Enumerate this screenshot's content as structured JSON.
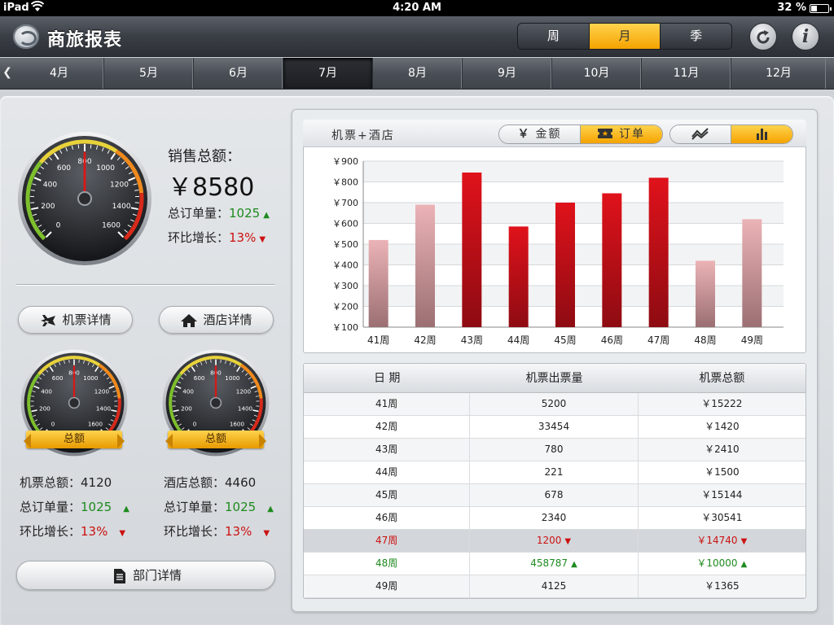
{
  "status_bar": {
    "device": "iPad",
    "time": "4:20 AM",
    "battery": "32 %"
  },
  "header": {
    "title": "商旅报表",
    "periods": [
      {
        "label": "周"
      },
      {
        "label": "月",
        "active": true
      },
      {
        "label": "季"
      }
    ],
    "refresh_icon": "refresh-icon",
    "info_icon": "info-icon",
    "info_label": "i"
  },
  "months": {
    "items": [
      "4月",
      "5月",
      "6月",
      "7月",
      "8月",
      "9月",
      "10月",
      "11月",
      "12月"
    ],
    "active": "7月"
  },
  "summary": {
    "sales_label": "销售总额：",
    "sales_value": "￥8580",
    "orders_label": "总订单量：",
    "orders_value": "1025",
    "growth_label": "环比增长：",
    "growth_value": "13%",
    "gauge_ticks": [
      "0",
      "200",
      "400",
      "600",
      "800",
      "1000",
      "1200",
      "1400",
      "1600"
    ],
    "gauge_needle_value": 800
  },
  "buttons": {
    "flight_details": "机票详情",
    "hotel_details": "酒店详情",
    "dept_details": "部门详情"
  },
  "flight": {
    "ribbon": "总额",
    "total_label": "机票总额：",
    "total_value": "4120",
    "orders_label": "总订单量：",
    "orders_value": "1025",
    "growth_label": "环比增长：",
    "growth_value": "13%",
    "gauge_needle_value": 800
  },
  "hotel": {
    "ribbon": "总额",
    "total_label": "酒店总额：",
    "total_value": "4460",
    "orders_label": "总订单量：",
    "orders_value": "1025",
    "growth_label": "环比增长：",
    "growth_value": "13%",
    "gauge_needle_value": 800
  },
  "chart_panel": {
    "title": "机票+酒店",
    "metric_options": [
      {
        "icon": "yen-icon",
        "label": "金额"
      },
      {
        "icon": "ticket-icon",
        "label": "订单",
        "active": true
      }
    ],
    "chart_type_options": [
      {
        "icon": "line-chart-icon"
      },
      {
        "icon": "bar-chart-icon",
        "active": true
      }
    ]
  },
  "chart_data": {
    "type": "bar",
    "title": "机票+酒店",
    "categories": [
      "41周",
      "42周",
      "43周",
      "44周",
      "45周",
      "46周",
      "47周",
      "48周",
      "49周"
    ],
    "values": [
      520,
      690,
      845,
      585,
      700,
      745,
      820,
      420,
      620
    ],
    "highlight": [
      false,
      false,
      true,
      true,
      true,
      true,
      true,
      false,
      false
    ],
    "ylim": [
      100,
      900
    ],
    "y_ticks": [
      "￥900",
      "￥800",
      "￥700",
      "￥600",
      "￥500",
      "￥400",
      "￥300",
      "￥200",
      "￥100"
    ],
    "grid": true,
    "colors": {
      "highlight": "#d4141c",
      "normal": "#e3a2a6"
    }
  },
  "table": {
    "headers": [
      "日 期",
      "机票出票量",
      "机票总额"
    ],
    "rows": [
      {
        "date": "41周",
        "count": "5200",
        "amount": "￥15222",
        "status": ""
      },
      {
        "date": "42周",
        "count": "33454",
        "amount": "￥1420",
        "status": ""
      },
      {
        "date": "43周",
        "count": "780",
        "amount": "￥2410",
        "status": ""
      },
      {
        "date": "44周",
        "count": "221",
        "amount": "￥1500",
        "status": ""
      },
      {
        "date": "45周",
        "count": "678",
        "amount": "￥15144",
        "status": ""
      },
      {
        "date": "46周",
        "count": "2340",
        "amount": "￥30541",
        "status": ""
      },
      {
        "date": "47周",
        "count": "1200",
        "amount": "￥14740",
        "status": "down"
      },
      {
        "date": "48周",
        "count": "458787",
        "amount": "￥10000",
        "status": "up"
      },
      {
        "date": "49周",
        "count": "4125",
        "amount": "￥1365",
        "status": ""
      }
    ]
  },
  "colors": {
    "accent": "#f5a300",
    "up": "#1e8a1e",
    "down": "#cc1111"
  }
}
